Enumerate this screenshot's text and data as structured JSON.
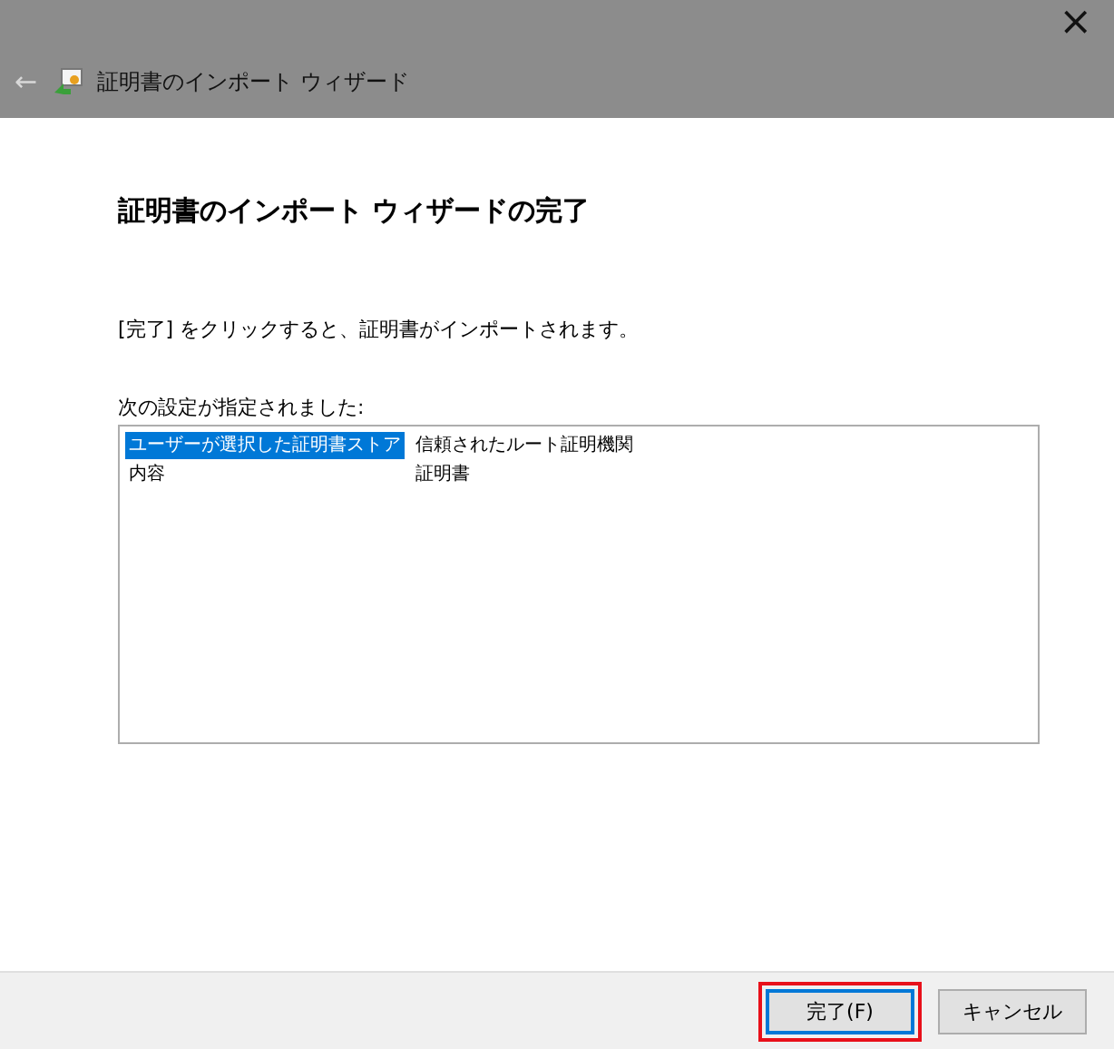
{
  "window": {
    "close": "×",
    "back": "←",
    "title": "証明書のインポート ウィザード"
  },
  "heading": "証明書のインポート ウィザードの完了",
  "description": "[完了] をクリックすると、証明書がインポートされます。",
  "settings_label": "次の設定が指定されました:",
  "settings": [
    {
      "name": "ユーザーが選択した証明書ストア",
      "value": "信頼されたルート証明機関",
      "selected": true
    },
    {
      "name": "内容",
      "value": "証明書",
      "selected": false
    }
  ],
  "buttons": [
    {
      "label": "完了(F)",
      "default": true,
      "highlighted": true
    },
    {
      "label": "キャンセル",
      "default": false,
      "highlighted": false
    }
  ]
}
